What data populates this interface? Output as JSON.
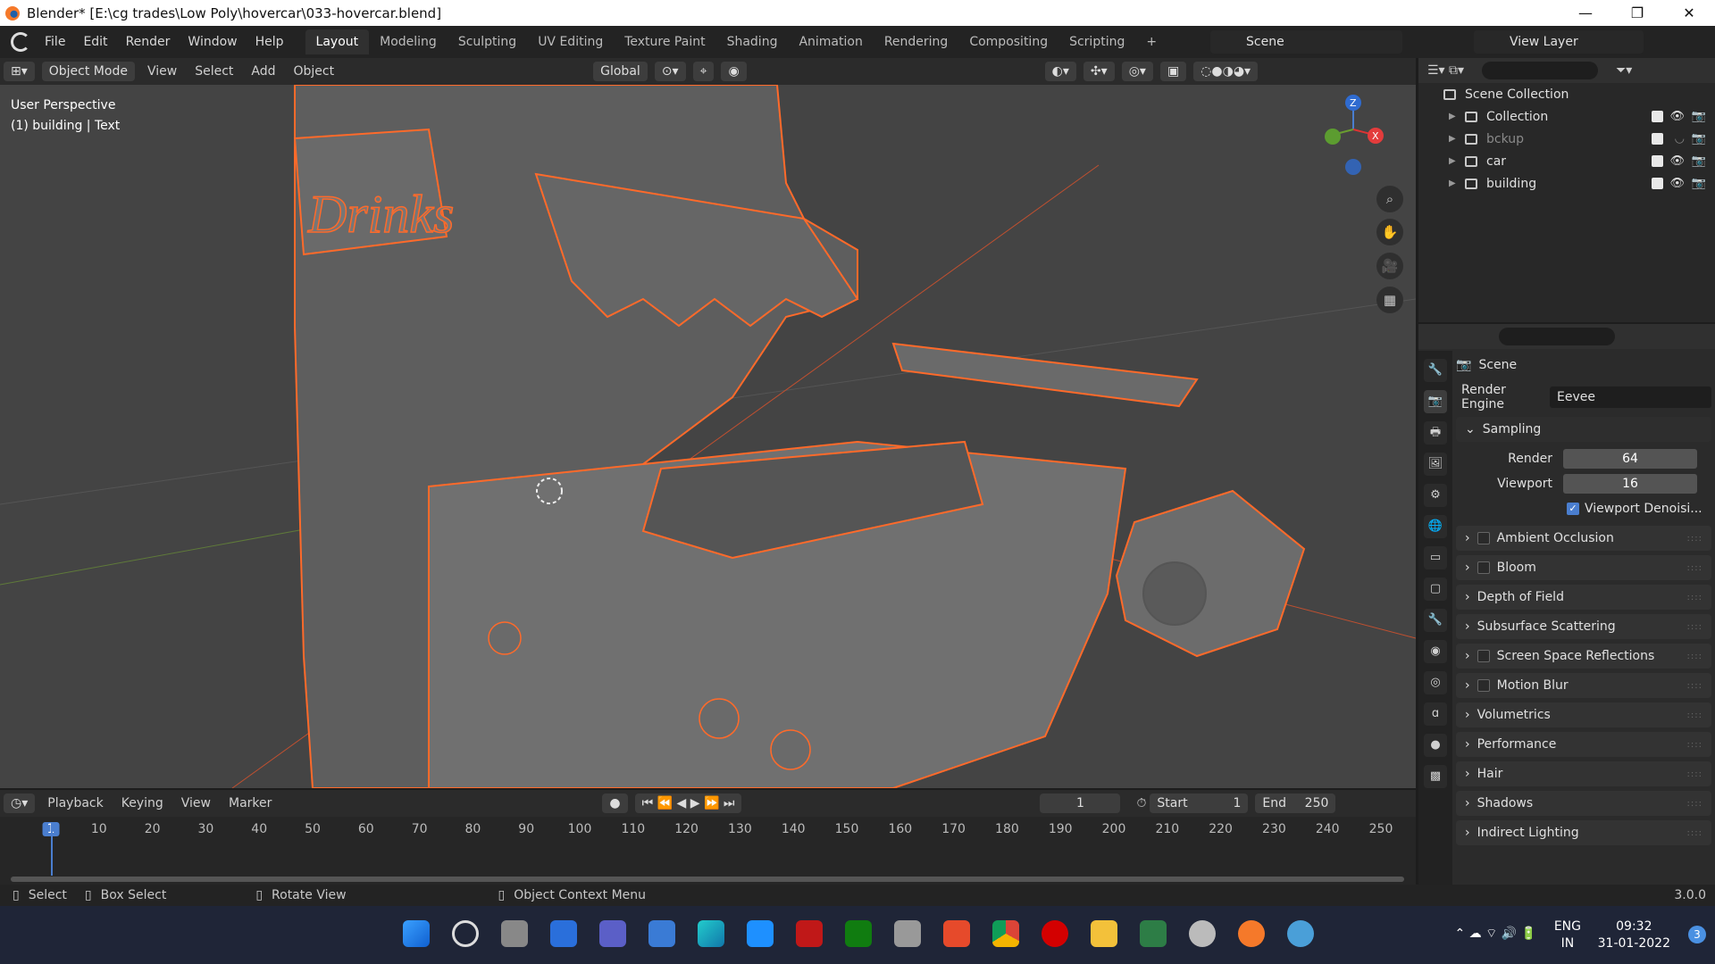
{
  "window": {
    "title": "Blender* [E:\\cg trades\\Low Poly\\hovercar\\033-hovercar.blend]"
  },
  "menu": [
    "File",
    "Edit",
    "Render",
    "Window",
    "Help"
  ],
  "workspaces": [
    "Layout",
    "Modeling",
    "Sculpting",
    "UV Editing",
    "Texture Paint",
    "Shading",
    "Animation",
    "Rendering",
    "Compositing",
    "Scripting",
    "+"
  ],
  "scene": "Scene",
  "view_layer": "View Layer",
  "header3d": {
    "mode": "Object Mode",
    "menus": [
      "View",
      "Select",
      "Add",
      "Object"
    ],
    "orientation": "Global"
  },
  "viewport": {
    "perspective": "User Perspective",
    "object": "(1) building | Text"
  },
  "outliner": {
    "root": "Scene Collection",
    "items": [
      {
        "label": "Collection",
        "dim": false
      },
      {
        "label": "bckup",
        "dim": true
      },
      {
        "label": "car",
        "dim": false
      },
      {
        "label": "building",
        "dim": false
      }
    ]
  },
  "props": {
    "title": "Scene",
    "render_engine_label": "Render Engine",
    "render_engine": "Eevee",
    "sampling": "Sampling",
    "render_label": "Render",
    "render_val": "64",
    "viewport_label": "Viewport",
    "viewport_val": "16",
    "denoise": "Viewport Denoisi...",
    "panels": [
      {
        "label": "Ambient Occlusion",
        "cb": true
      },
      {
        "label": "Bloom",
        "cb": true
      },
      {
        "label": "Depth of Field",
        "cb": false
      },
      {
        "label": "Subsurface Scattering",
        "cb": false
      },
      {
        "label": "Screen Space Reflections",
        "cb": true
      },
      {
        "label": "Motion Blur",
        "cb": true
      },
      {
        "label": "Volumetrics",
        "cb": false
      },
      {
        "label": "Performance",
        "cb": false
      },
      {
        "label": "Hair",
        "cb": false
      },
      {
        "label": "Shadows",
        "cb": false
      },
      {
        "label": "Indirect Lighting",
        "cb": false
      }
    ]
  },
  "timeline": {
    "menus": [
      "Playback",
      "Keying",
      "View",
      "Marker"
    ],
    "frame": "1",
    "start_label": "Start",
    "start": "1",
    "end_label": "End",
    "end": "250",
    "ticks": [
      "1",
      "10",
      "20",
      "30",
      "40",
      "50",
      "60",
      "70",
      "80",
      "90",
      "100",
      "110",
      "120",
      "130",
      "140",
      "150",
      "160",
      "170",
      "180",
      "190",
      "200",
      "210",
      "220",
      "230",
      "240",
      "250"
    ]
  },
  "status": {
    "select": "Select",
    "box": "Box Select",
    "rotate": "Rotate View",
    "context": "Object Context Menu",
    "version": "3.0.0"
  },
  "tray": {
    "lang1": "ENG",
    "lang2": "IN",
    "time": "09:32",
    "date": "31-01-2022",
    "notif": "3"
  }
}
